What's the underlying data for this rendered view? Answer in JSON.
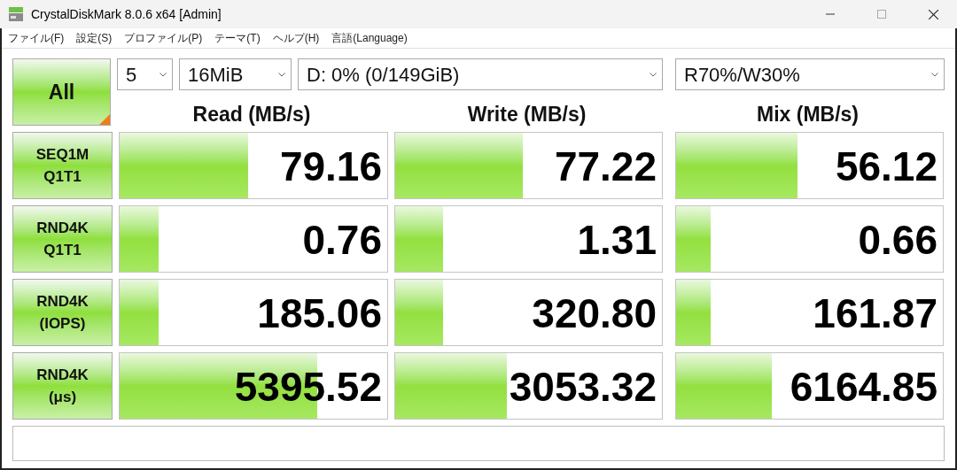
{
  "window": {
    "title": "CrystalDiskMark 8.0.6 x64 [Admin]"
  },
  "menu": [
    "ファイル(F)",
    "設定(S)",
    "プロファイル(P)",
    "テーマ(T)",
    "ヘルプ(H)",
    "言語(Language)"
  ],
  "all_button": {
    "label": "All"
  },
  "selectors": [
    {
      "value": "5"
    },
    {
      "value": "16MiB"
    },
    {
      "value": "D: 0% (0/149GiB)"
    },
    {
      "value": "R70%/W30%"
    }
  ],
  "columns": [
    "Read (MB/s)",
    "Write (MB/s)",
    "Mix (MB/s)"
  ],
  "rows": [
    {
      "label": [
        "SEQ1M",
        "Q1T1"
      ],
      "results": [
        {
          "value": "79.16",
          "level": 0.48
        },
        {
          "value": "77.22",
          "level": 0.48
        },
        {
          "value": "56.12",
          "level": 0.455
        }
      ]
    },
    {
      "label": [
        "RND4K",
        "Q1T1"
      ],
      "results": [
        {
          "value": "0.76",
          "level": 0.145
        },
        {
          "value": "1.31",
          "level": 0.18
        },
        {
          "value": "0.66",
          "level": 0.13
        }
      ]
    },
    {
      "label": [
        "RND4K",
        "(IOPS)"
      ],
      "results": [
        {
          "value": "185.06",
          "level": 0.145
        },
        {
          "value": "320.80",
          "level": 0.18
        },
        {
          "value": "161.87",
          "level": 0.13
        }
      ]
    },
    {
      "label": [
        "RND4K",
        "(μs)"
      ],
      "results": [
        {
          "value": "5395.52",
          "level": 0.74
        },
        {
          "value": "3053.32",
          "level": 0.42
        },
        {
          "value": "6164.85",
          "level": 0.36
        }
      ]
    }
  ]
}
